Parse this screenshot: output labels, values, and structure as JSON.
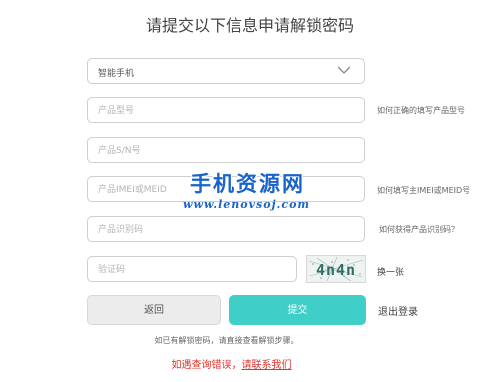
{
  "page": {
    "title": "请提交以下信息申请解锁密码"
  },
  "form": {
    "device_type": {
      "value": "智能手机"
    },
    "model": {
      "placeholder": "产品型号",
      "hint": "如何正确的填写产品型号"
    },
    "sn": {
      "placeholder": "产品S/N号"
    },
    "imei": {
      "placeholder": "产品IMEI或MEID",
      "hint": "如何填写主IMEI或MEID号"
    },
    "product_id": {
      "placeholder": "产品识别码",
      "hint": "如何获得产品识别码？"
    },
    "captcha": {
      "placeholder": "验证码",
      "image_text": "4n4n",
      "refresh_label": "换一张"
    }
  },
  "actions": {
    "back_label": "返回",
    "submit_label": "提交",
    "logout_label": "退出登录"
  },
  "note": "如已有解锁密码，请直接查看解锁步骤。",
  "error": {
    "prefix": "如遇查询错误，",
    "contact": "请联系我们"
  },
  "watermark": {
    "line1": "手机资源网",
    "line2": "www.lenovsoj.com"
  },
  "colors": {
    "accent": "#3fcfc8",
    "error": "#e0312b",
    "watermark": "#1a63c9"
  }
}
